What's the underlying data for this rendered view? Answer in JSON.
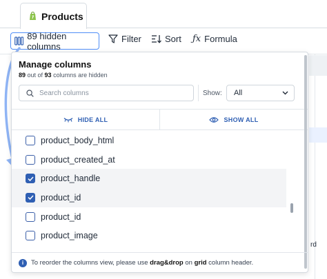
{
  "tab": {
    "label": "Products"
  },
  "toolbar": {
    "hidden_columns_label": "89 hidden columns",
    "filter_label": "Filter",
    "sort_label": "Sort",
    "formula_label": "Formula"
  },
  "panel": {
    "title": "Manage columns",
    "hidden_count": "89",
    "total_count": "93",
    "out_of_text": " out of ",
    "hidden_text": " columns are hidden",
    "search_placeholder": "Search columns",
    "show_label": "Show:",
    "show_value": "All",
    "hide_all_label": "HIDE ALL",
    "show_all_label": "SHOW ALL",
    "columns": [
      {
        "name": "product_body_html",
        "checked": false
      },
      {
        "name": "product_created_at",
        "checked": false
      },
      {
        "name": "product_handle",
        "checked": true
      },
      {
        "name": "product_id",
        "checked": true
      },
      {
        "name": "product_id",
        "checked": false
      },
      {
        "name": "product_image",
        "checked": false
      }
    ],
    "footer": {
      "prefix": "To reorder the columns view, please use ",
      "bold1": "drag&drop",
      "middle": " on ",
      "bold2": "grid",
      "suffix": " column header."
    }
  },
  "background": {
    "right_peek_text": "rd"
  },
  "colors": {
    "accent": "#2f5fb3",
    "highlight_border": "#4f8ef7",
    "arrow": "#8fb4f5"
  }
}
